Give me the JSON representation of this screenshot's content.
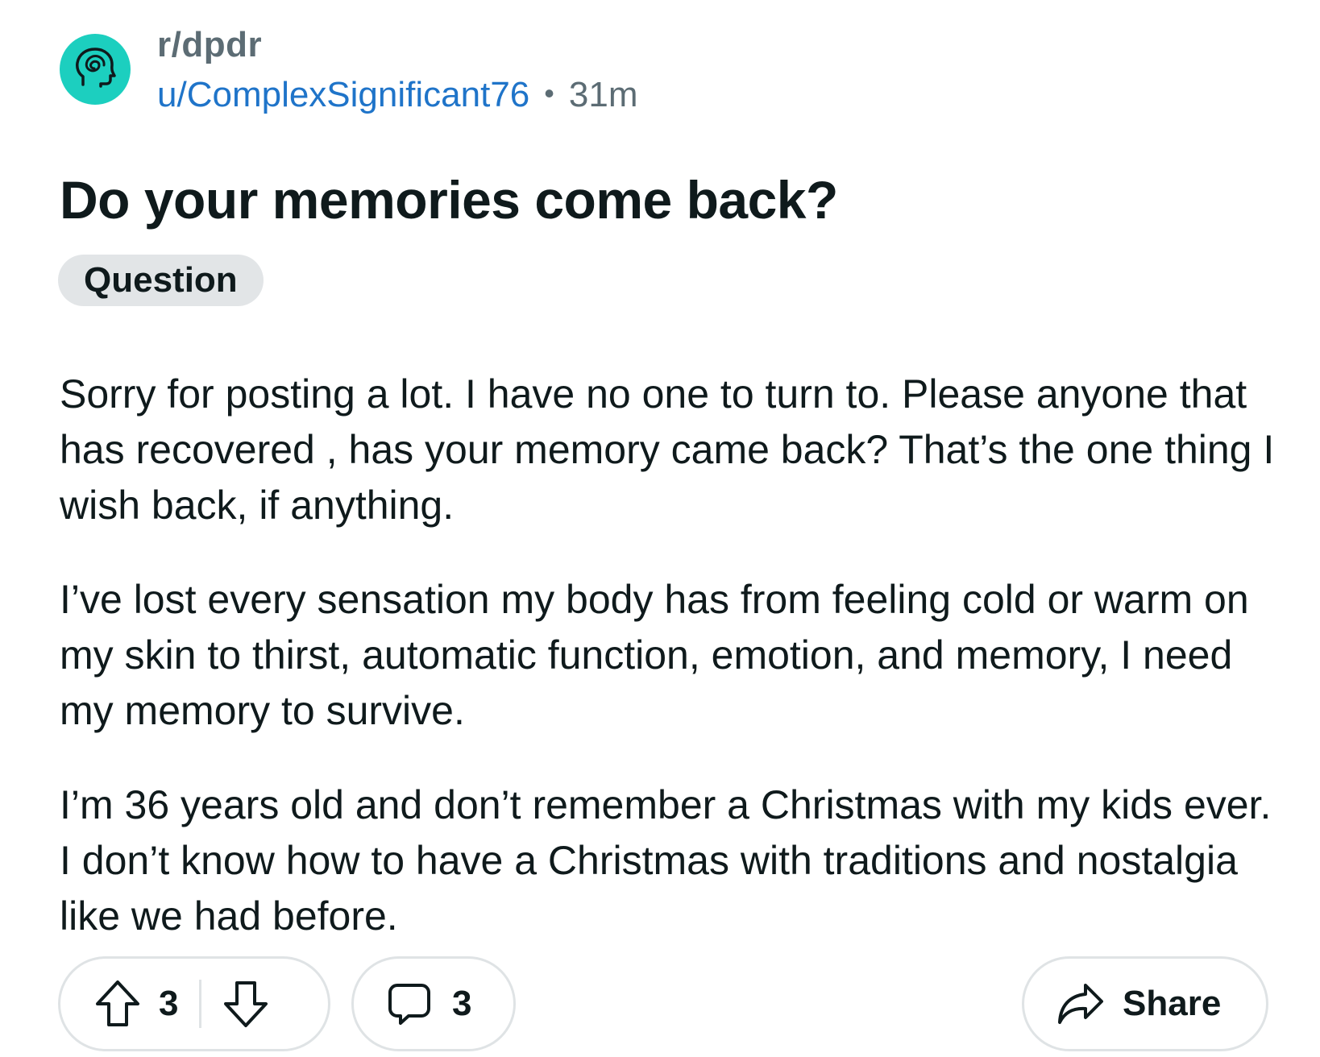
{
  "post": {
    "subreddit": "r/dpdr",
    "author": "u/ComplexSignificant76",
    "separator": "•",
    "age": "31m",
    "title": "Do your memories come back?",
    "flair": "Question",
    "body": [
      "Sorry for posting a lot. I have no one to turn to. Please anyone that has recovered , has your memory came back? That’s the one thing I wish back, if anything.",
      "I’ve lost every sensation my body has from feeling cold or warm on my skin to thirst, automatic function, emotion, and memory, I need my memory to survive.",
      "I’m 36 years old and don’t remember a Christmas with my kids ever. I don’t know how to have a Christmas with traditions and nostalgia like we had before."
    ]
  },
  "actions": {
    "score": "3",
    "comments": "3",
    "share_label": "Share"
  },
  "icons": {
    "avatar": "subreddit-avatar-head-icon",
    "upvote": "upvote-arrow-icon",
    "downvote": "downvote-arrow-icon",
    "comment": "comment-bubble-icon",
    "share": "share-arrow-icon"
  },
  "colors": {
    "avatar_bg": "#1ccfbf",
    "username": "#1f74c9",
    "muted": "#5c6c74",
    "flair_bg": "#e2e5e7",
    "border": "#dfe3e5"
  }
}
